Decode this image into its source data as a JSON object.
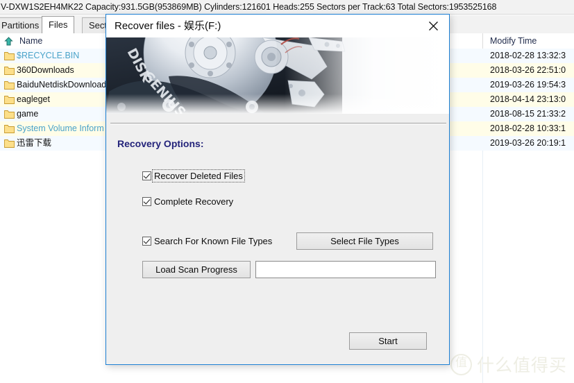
{
  "app": {
    "info_bar": "V-DXW1S2EH4MK22  Capacity:931.5GB(953869MB)  Cylinders:121601  Heads:255  Sectors per Track:63  Total Sectors:1953525168",
    "tabs": [
      {
        "label": "Partitions",
        "active": false
      },
      {
        "label": "Files",
        "active": true
      },
      {
        "label": "Sect",
        "active": false
      }
    ],
    "list": {
      "columns": {
        "name": "Name",
        "modify_time": "Modify Time"
      },
      "sort_icon": "sort-ascending-arrow-icon",
      "rows": [
        {
          "icon": "folder-icon",
          "name": "$RECYCLE.BIN",
          "name_color": "teal",
          "modify_time": "2018-02-28 13:32:3"
        },
        {
          "icon": "folder-icon",
          "name": "360Downloads",
          "name_color": "normal",
          "modify_time": "2018-03-26 22:51:0"
        },
        {
          "icon": "folder-icon",
          "name": "BaiduNetdiskDownload",
          "name_color": "normal",
          "modify_time": "2019-03-26 19:54:3"
        },
        {
          "icon": "folder-icon",
          "name": "eagleget",
          "name_color": "normal",
          "modify_time": "2018-04-14 23:13:0"
        },
        {
          "icon": "folder-icon",
          "name": "game",
          "name_color": "normal",
          "modify_time": "2018-08-15 21:33:2"
        },
        {
          "icon": "folder-icon",
          "name": "System Volume Inform",
          "name_color": "teal",
          "modify_time": "2018-02-28 10:33:1"
        },
        {
          "icon": "folder-icon",
          "name": "迅雷下载",
          "name_color": "normal",
          "modify_time": "2019-03-26 20:19:1"
        }
      ]
    }
  },
  "watermark": {
    "logo_char": "值",
    "text": "什么值得买"
  },
  "dialog": {
    "title": "Recover files - 娱乐(F:)",
    "close_icon": "close-icon",
    "banner_text": "DISK GENIUS",
    "section_title": "Recovery Options:",
    "options": [
      {
        "label": "Recover Deleted Files",
        "checked": true,
        "focused": true
      },
      {
        "label": "Complete Recovery",
        "checked": true,
        "focused": false
      },
      {
        "label": "Search For Known File Types",
        "checked": true,
        "focused": false
      }
    ],
    "buttons": {
      "select_file_types": "Select File Types",
      "load_scan_progress": "Load Scan Progress",
      "start": "Start"
    },
    "path_input": {
      "value": "",
      "placeholder": ""
    }
  },
  "colors": {
    "dialog_border": "#1b7fd4",
    "section_title": "#23237a",
    "row_odd": "#f5faff",
    "row_even": "#fffde8",
    "teal_text": "#4aa3c9"
  }
}
